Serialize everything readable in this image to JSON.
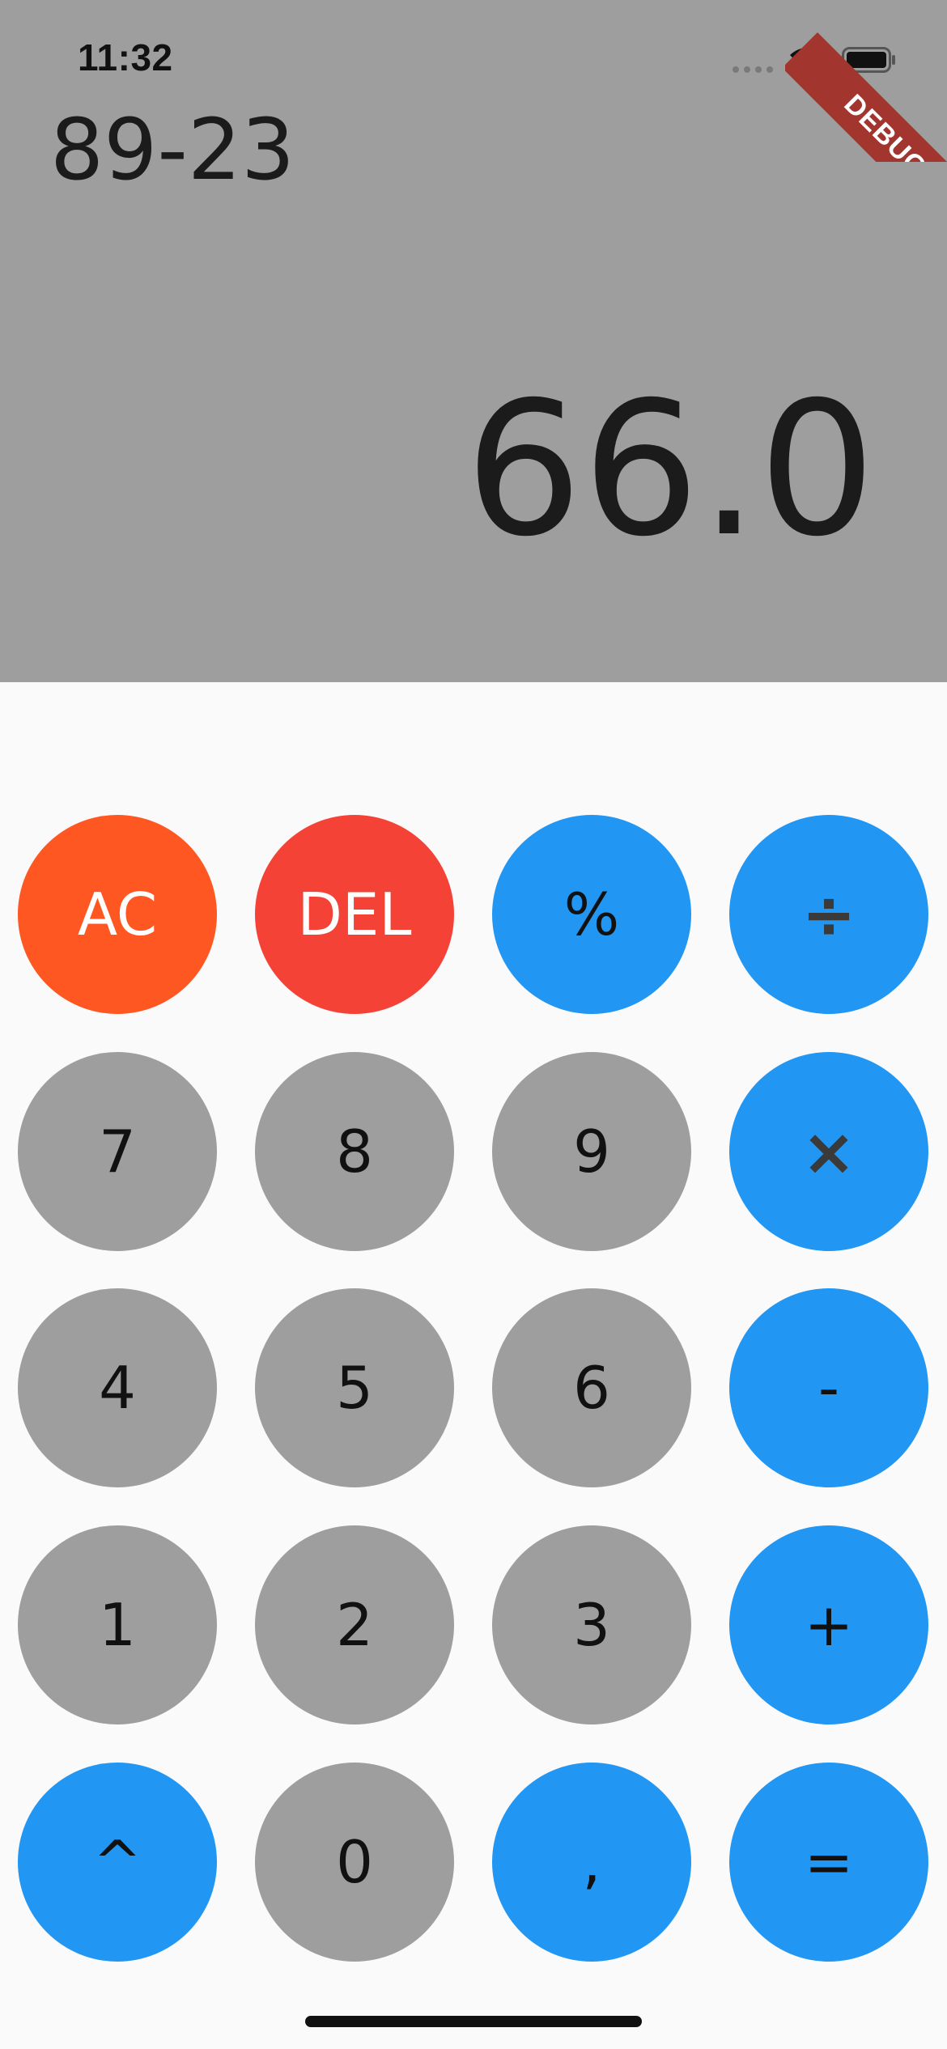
{
  "status_bar": {
    "time": "11:32",
    "debug_label": "DEBUG"
  },
  "display": {
    "expression": "89-23",
    "result": "66.0"
  },
  "keypad": {
    "rows": [
      [
        {
          "label": "AC",
          "style": "orange",
          "name": "all-clear-button"
        },
        {
          "label": "DEL",
          "style": "red",
          "name": "delete-button"
        },
        {
          "label": "%",
          "style": "blue",
          "name": "percent-button"
        },
        {
          "label": "÷",
          "style": "blue-op",
          "name": "divide-button"
        }
      ],
      [
        {
          "label": "7",
          "style": "grey",
          "name": "digit-7-button"
        },
        {
          "label": "8",
          "style": "grey",
          "name": "digit-8-button"
        },
        {
          "label": "9",
          "style": "grey",
          "name": "digit-9-button"
        },
        {
          "label": "×",
          "style": "blue-op",
          "name": "multiply-button"
        }
      ],
      [
        {
          "label": "4",
          "style": "grey",
          "name": "digit-4-button"
        },
        {
          "label": "5",
          "style": "grey",
          "name": "digit-5-button"
        },
        {
          "label": "6",
          "style": "grey",
          "name": "digit-6-button"
        },
        {
          "label": "-",
          "style": "blue",
          "name": "subtract-button"
        }
      ],
      [
        {
          "label": "1",
          "style": "grey",
          "name": "digit-1-button"
        },
        {
          "label": "2",
          "style": "grey",
          "name": "digit-2-button"
        },
        {
          "label": "3",
          "style": "grey",
          "name": "digit-3-button"
        },
        {
          "label": "+",
          "style": "blue",
          "name": "add-button"
        }
      ],
      [
        {
          "label": "^",
          "style": "blue",
          "name": "power-button"
        },
        {
          "label": "0",
          "style": "grey",
          "name": "digit-0-button"
        },
        {
          "label": ",",
          "style": "blue",
          "name": "decimal-button"
        },
        {
          "label": "=",
          "style": "blue",
          "name": "equals-button"
        }
      ]
    ]
  },
  "colors": {
    "display_background": "#9e9e9e",
    "keypad_background": "#fafafa",
    "number_key": "#9e9e9e",
    "operator_key": "#2196f3",
    "clear_key": "#ff5722",
    "delete_key": "#f44336",
    "debug_banner": "#a3352f"
  }
}
